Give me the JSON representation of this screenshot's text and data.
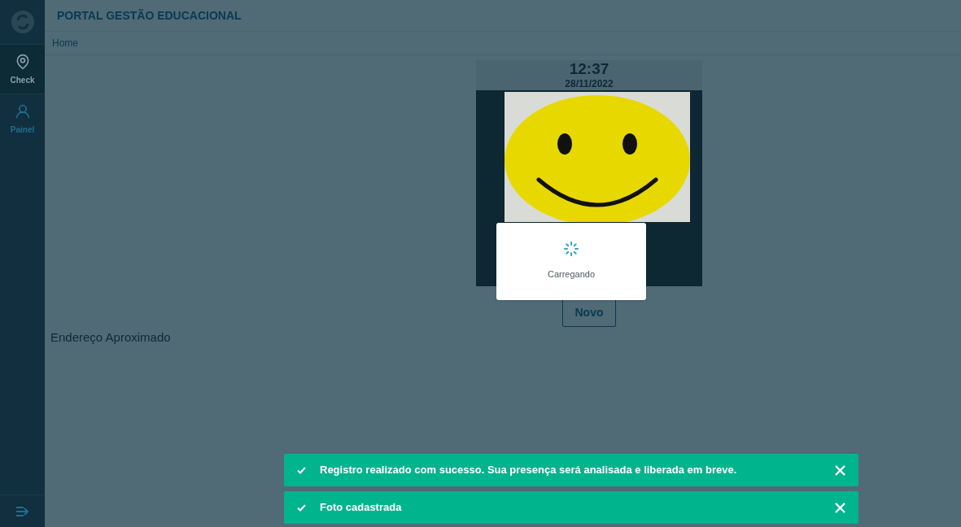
{
  "header": {
    "title": "PORTAL GESTÃO EDUCACIONAL"
  },
  "breadcrumb": [
    "Home"
  ],
  "sidebar": {
    "items": [
      {
        "label": "Check",
        "kind": "pin",
        "selected": true
      },
      {
        "label": "Painel",
        "kind": "user",
        "selected": false
      }
    ]
  },
  "camera": {
    "time": "12:37",
    "date": "28/11/2022"
  },
  "loading": {
    "text": "Carregando"
  },
  "new_button": "Novo",
  "address": {
    "title": "Endereço Aproximado"
  },
  "toasts": [
    {
      "text": "Registro realizado com sucesso. Sua presença será analisada e liberada em breve."
    },
    {
      "text": "Foto cadastrada"
    }
  ]
}
